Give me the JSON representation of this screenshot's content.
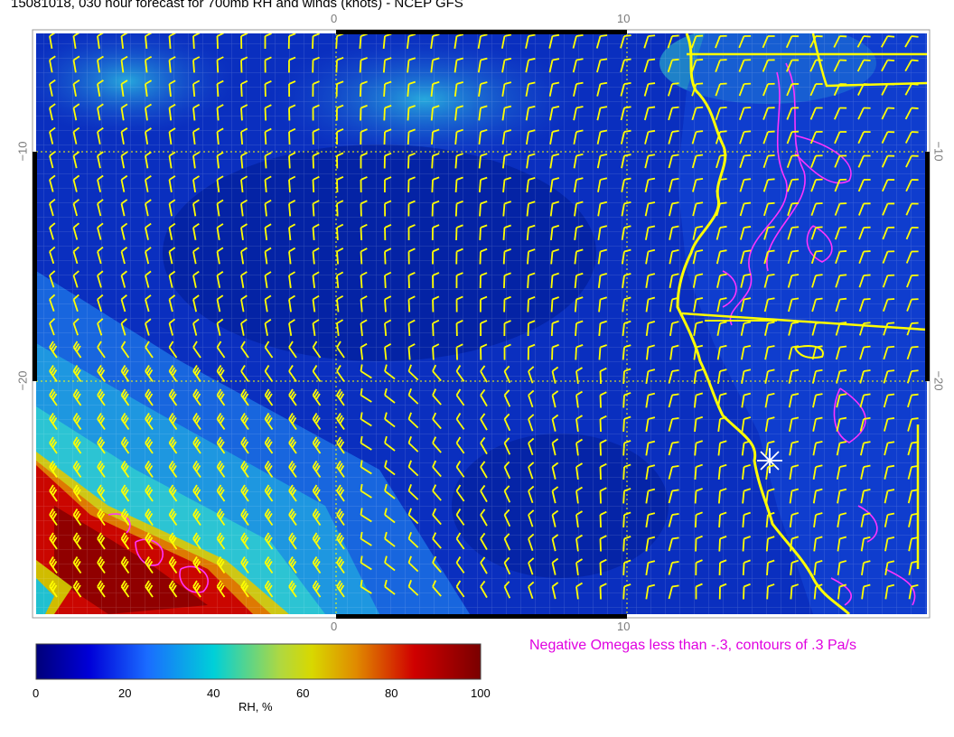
{
  "title": "15081018, 030 hour forecast for 700mb RH and winds (knots) - NCEP GFS",
  "axes": {
    "top_ticks": [
      "0",
      "10"
    ],
    "bottom_ticks": [
      "0",
      "10"
    ],
    "left_ticks": [
      "−10",
      "−20"
    ],
    "right_ticks": [
      "−10",
      "−20"
    ]
  },
  "omega_note": "Negative Omegas less than -.3, contours of .3 Pa/s",
  "colorbar": {
    "ticks": [
      "0",
      "20",
      "40",
      "60",
      "80",
      "100"
    ],
    "label": "RH, %",
    "range": [
      0,
      100
    ]
  },
  "colors": {
    "rh_low": "#000a8c",
    "rh_mid": "#00c8c8",
    "rh_high": "#8c0000",
    "wind_barbs": "#ffff00",
    "coastline": "#ffff00",
    "omega_contours": "#ff33ff",
    "omega_note": "#e000e0",
    "tick_labels": "#7a7a7a"
  },
  "icons": {
    "wind_barb": "wind-barb-icon",
    "location_marker": "asterisk-icon"
  }
}
